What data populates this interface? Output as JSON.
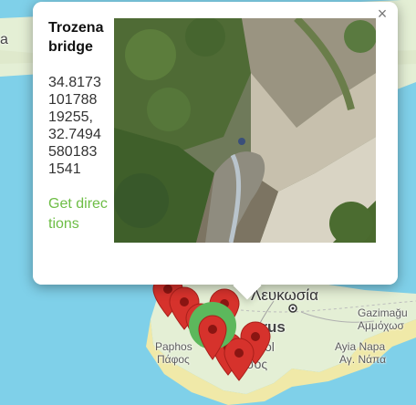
{
  "map": {
    "labels": {
      "edge": "a",
      "nicosia": "Λευκωσία",
      "cyprus": "prus",
      "gazimagusa": "Gazimağu",
      "ammochostos": "Αμμόχωσ",
      "ayia_napa": "Ayia Napa",
      "ayia_napa_gr": "Αγ. Νάπα",
      "paphos": "Paphos",
      "paphos_gr": "Πάφος",
      "limassol": "sol",
      "limassol_gr": "σός"
    },
    "colors": {
      "sea": "#7fd0e9",
      "land": "#e4efd5",
      "land_south": "#f0e9a8",
      "marker_red": "#d6322c",
      "marker_green": "#5cb85c"
    }
  },
  "popup": {
    "title": "Trozena bridge",
    "coordinates": "34.8173101788 19255, 32.7494580183 1541",
    "directions_label": "Get directions",
    "close_icon": "×",
    "link_color": "#6dbd45"
  }
}
